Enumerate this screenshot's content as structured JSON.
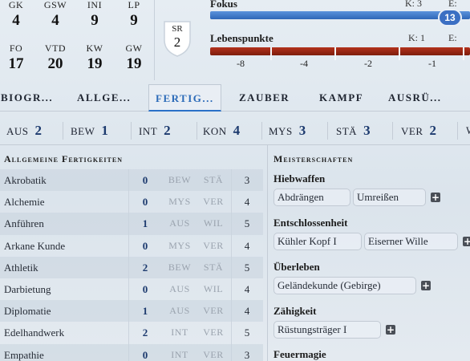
{
  "header": {
    "attributes_top": [
      {
        "label": "GK",
        "value": "4"
      },
      {
        "label": "GSW",
        "value": "4"
      },
      {
        "label": "INI",
        "value": "9"
      },
      {
        "label": "LP",
        "value": "9"
      }
    ],
    "attributes_bottom": [
      {
        "label": "FO",
        "value": "17"
      },
      {
        "label": "VTD",
        "value": "20"
      },
      {
        "label": "KW",
        "value": "19"
      },
      {
        "label": "GW",
        "value": "19"
      }
    ],
    "sr": {
      "label": "SR",
      "value": "2"
    },
    "fokus": {
      "label": "Fokus",
      "k_label": "K:",
      "k_value": "3",
      "e_label": "E:",
      "value": "13",
      "fill_fraction": 1.0,
      "color": "#3b6fc3"
    },
    "lebenspunkte": {
      "label": "Lebenspunkte",
      "k_label": "K:",
      "k_value": "1",
      "e_label": "E:",
      "color": "#9a2814",
      "ticks": [
        "-8",
        "-4",
        "-2",
        "-1"
      ]
    }
  },
  "tabs": [
    {
      "label": "BIOGR...",
      "active": false
    },
    {
      "label": "ALLGE...",
      "active": false
    },
    {
      "label": "FERTIG...",
      "active": true
    },
    {
      "label": "ZAUBER",
      "active": false
    },
    {
      "label": "KAMPF",
      "active": false
    },
    {
      "label": "AUSRÜ...",
      "active": false
    }
  ],
  "attribute_strip": [
    {
      "key": "AUS",
      "value": "2"
    },
    {
      "key": "BEW",
      "value": "1"
    },
    {
      "key": "INT",
      "value": "2"
    },
    {
      "key": "KON",
      "value": "4"
    },
    {
      "key": "MYS",
      "value": "3"
    },
    {
      "key": "STÄ",
      "value": "3"
    },
    {
      "key": "VER",
      "value": "2"
    },
    {
      "key": "W",
      "value": ""
    }
  ],
  "skills_panel": {
    "title": "Allgemeine Fertigkeiten",
    "rows": [
      {
        "name": "Akrobatik",
        "value": "0",
        "attr1": "BEW",
        "attr2": "STÄ",
        "cost": "3"
      },
      {
        "name": "Alchemie",
        "value": "0",
        "attr1": "MYS",
        "attr2": "VER",
        "cost": "4"
      },
      {
        "name": "Anführen",
        "value": "1",
        "attr1": "AUS",
        "attr2": "WIL",
        "cost": "5"
      },
      {
        "name": "Arkane Kunde",
        "value": "0",
        "attr1": "MYS",
        "attr2": "VER",
        "cost": "4"
      },
      {
        "name": "Athletik",
        "value": "2",
        "attr1": "BEW",
        "attr2": "STÄ",
        "cost": "5"
      },
      {
        "name": "Darbietung",
        "value": "0",
        "attr1": "AUS",
        "attr2": "WIL",
        "cost": "4"
      },
      {
        "name": "Diplomatie",
        "value": "1",
        "attr1": "AUS",
        "attr2": "VER",
        "cost": "4"
      },
      {
        "name": "Edelhandwerk",
        "value": "2",
        "attr1": "INT",
        "attr2": "VER",
        "cost": "5"
      },
      {
        "name": "Empathie",
        "value": "0",
        "attr1": "INT",
        "attr2": "VER",
        "cost": "3"
      }
    ]
  },
  "mastery_panel": {
    "title": "Meisterschaften",
    "groups": [
      {
        "title": "Hiebwaffen",
        "items": [
          "Abdrängen",
          "Umreißen"
        ]
      },
      {
        "title": "Entschlossenheit",
        "items": [
          "Kühler Kopf I",
          "Eiserner Wille"
        ]
      },
      {
        "title": "Überleben",
        "items": [
          "Geländekunde (Gebirge)"
        ]
      },
      {
        "title": "Zähigkeit",
        "items": [
          "Rüstungsträger I"
        ]
      },
      {
        "title": "Feuermagie",
        "items": []
      }
    ],
    "add_symbol": "+"
  }
}
